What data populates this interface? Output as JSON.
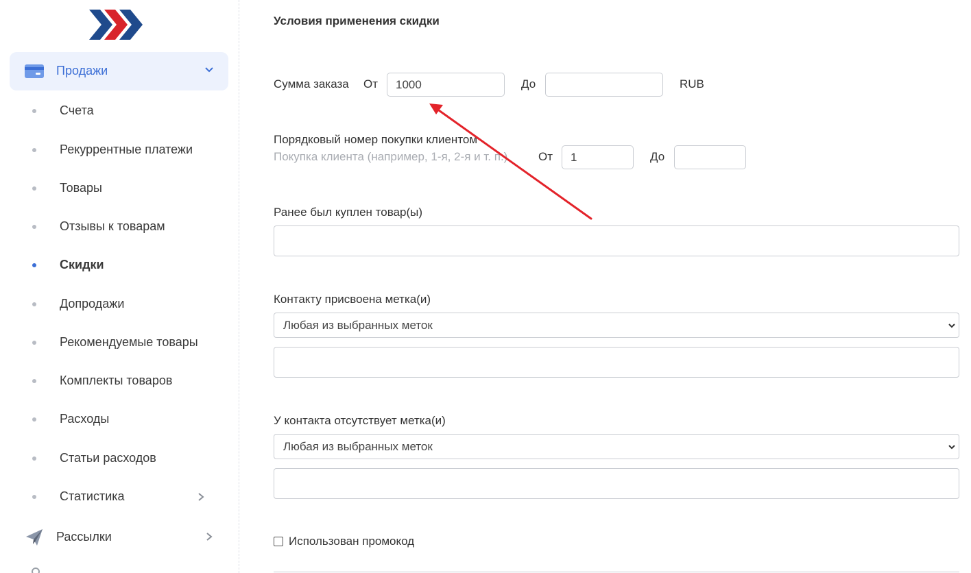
{
  "colors": {
    "accent": "#3c6fd6",
    "accent_bg": "#edf2fd",
    "arrow": "#e3232a",
    "logo_blue": "#1f4a8c",
    "logo_red": "#d8242b"
  },
  "sidebar": {
    "sales": {
      "label": "Продажи",
      "icon": "credit-card-icon"
    },
    "items": [
      {
        "label": "Счета"
      },
      {
        "label": "Рекуррентные платежи"
      },
      {
        "label": "Товары"
      },
      {
        "label": "Отзывы к товарам"
      },
      {
        "label": "Скидки",
        "active": true
      },
      {
        "label": "Допродажи"
      },
      {
        "label": "Рекомендуемые товары"
      },
      {
        "label": "Комплекты товаров"
      },
      {
        "label": "Расходы"
      },
      {
        "label": "Статьи расходов"
      },
      {
        "label": "Статистика",
        "has_children": true
      }
    ],
    "mailing": {
      "label": "Рассылки",
      "icon": "paper-plane-icon"
    }
  },
  "form": {
    "section_title": "Условия применения скидки",
    "order_sum": {
      "label": "Сумма заказа",
      "from_label": "От",
      "from_value": "1000",
      "to_label": "До",
      "to_value": "",
      "currency": "RUB"
    },
    "purchase_number": {
      "label": "Порядковый номер покупки клиентом",
      "hint": "Покупка клиента (например, 1-я, 2-я и т. п.)",
      "from_label": "От",
      "from_value": "1",
      "to_label": "До",
      "to_value": ""
    },
    "bought_products": {
      "label": "Ранее был куплен товар(ы)"
    },
    "has_tags": {
      "label": "Контакту присвоена метка(и)",
      "select_value": "Любая из выбранных меток"
    },
    "missing_tags": {
      "label": "У контакта отсутствует метка(и)",
      "select_value": "Любая из выбранных меток"
    },
    "promo": {
      "label": "Использован промокод",
      "checked": false
    }
  }
}
